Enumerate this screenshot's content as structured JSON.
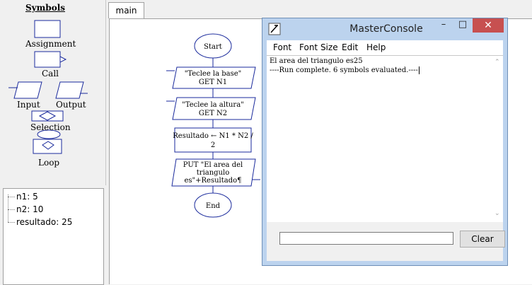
{
  "symbols_panel": {
    "title": "Symbols",
    "items": [
      "Assignment",
      "Call",
      "Input",
      "Output",
      "Selection",
      "Loop"
    ]
  },
  "variables": [
    {
      "label": "n1: 5"
    },
    {
      "label": "n2: 10"
    },
    {
      "label": "resultado: 25"
    }
  ],
  "tabs": [
    {
      "label": "main"
    }
  ],
  "flowchart": {
    "start": "Start",
    "get1_line1": "\"Teclee la base\"",
    "get1_line2": "GET N1",
    "get2_line1": "\"Teclee la altura\"",
    "get2_line2": "GET N2",
    "assign_line1": "Resultado ← N1 * N2 /",
    "assign_line2": "2",
    "put_line1": "PUT \"El area del",
    "put_line2": "triangulo",
    "put_line3": "es\"+Resultado¶",
    "end": "End"
  },
  "console": {
    "title": "MasterConsole",
    "menu": [
      "Font",
      "Font Size",
      "Edit",
      "Help"
    ],
    "output_line1": "El area del triangulo es25",
    "output_line2": "----Run complete.  6 symbols evaluated.----",
    "input_value": "",
    "clear_label": "Clear",
    "minimize_glyph": "–",
    "maximize_glyph": "□",
    "close_glyph": "✕"
  },
  "colors": {
    "flowchart_stroke": "#1a2a9c",
    "close_button": "#c75050",
    "console_frame": "#bcd3ee"
  }
}
